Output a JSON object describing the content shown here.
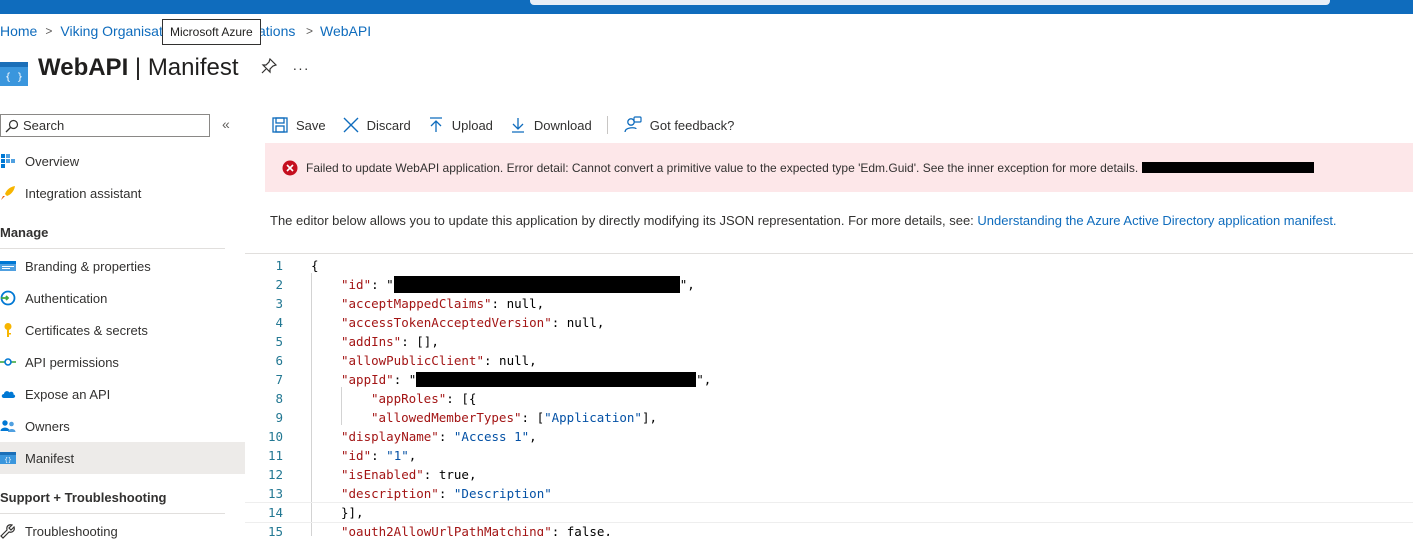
{
  "breadcrumb": {
    "home": "Home",
    "middle_start": "Viking Organisat",
    "middle_end": "ations",
    "current": "WebAPI",
    "tooltip": "Microsoft Azure"
  },
  "header": {
    "app_name": "WebAPI",
    "separator": "|",
    "page": "Manifest",
    "more": "···"
  },
  "sidebar": {
    "search_placeholder": "Search",
    "collapse": "«",
    "items": {
      "overview": "Overview",
      "integration": "Integration assistant",
      "manage": "Manage",
      "branding": "Branding & properties",
      "authentication": "Authentication",
      "certificates": "Certificates & secrets",
      "api_permissions": "API permissions",
      "expose_api": "Expose an API",
      "owners": "Owners",
      "manifest": "Manifest",
      "support": "Support + Troubleshooting",
      "troubleshooting": "Troubleshooting"
    }
  },
  "toolbar": {
    "save": "Save",
    "discard": "Discard",
    "upload": "Upload",
    "download": "Download",
    "feedback": "Got feedback?"
  },
  "error": {
    "message": "Failed to update WebAPI application. Error detail: Cannot convert a primitive value to the expected type 'Edm.Guid'. See the inner exception for more details."
  },
  "info": {
    "text": "The editor below allows you to update this application by directly modifying its JSON representation. For more details, see: ",
    "link": "Understanding the Azure Active Directory application manifest."
  },
  "editor": {
    "line_numbers": [
      "1",
      "2",
      "3",
      "4",
      "5",
      "6",
      "7",
      "8",
      "9",
      "10",
      "11",
      "12",
      "13",
      "14",
      "15"
    ],
    "lines": {
      "l1": "{",
      "l2_key": "\"id\"",
      "l2_pre": ": \"",
      "l2_post": "\",",
      "l3_key": "\"acceptMappedClaims\"",
      "l3_val": ": null,",
      "l4_key": "\"accessTokenAcceptedVersion\"",
      "l4_val": ": null,",
      "l5_key": "\"addIns\"",
      "l5_val": ": [],",
      "l6_key": "\"allowPublicClient\"",
      "l6_val": ": null,",
      "l7_key": "\"appId\"",
      "l7_pre": ": \"",
      "l7_post": "\",",
      "l8_key": "\"appRoles\"",
      "l8_val": ": [{",
      "l9_key": "\"allowedMemberTypes\"",
      "l9_val1": ": [",
      "l9_str": "\"Application\"",
      "l9_val2": "],",
      "l10_key": "\"displayName\"",
      "l10_sep": ": ",
      "l10_str": "\"Access 1\"",
      "l10_end": ",",
      "l11_key": "\"id\"",
      "l11_sep": ": ",
      "l11_str": "\"1\"",
      "l11_end": ",",
      "l12_key": "\"isEnabled\"",
      "l12_val": ": true,",
      "l13_key": "\"description\"",
      "l13_sep": ": ",
      "l13_str": "\"Description\"",
      "l14": "}],",
      "l15_key": "\"oauth2AllowUrlPathMatching\"",
      "l15_val": ": false,"
    }
  },
  "colors": {
    "accent": "#0f6cbd",
    "error_bg": "#fde7e9",
    "error_icon": "#c50f1f",
    "json_key": "#a31515",
    "json_string": "#0451a5",
    "line_number": "#237893"
  }
}
